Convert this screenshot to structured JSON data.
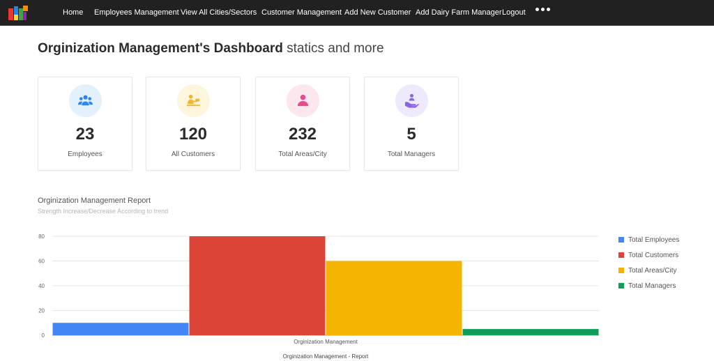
{
  "navbar": {
    "items": [
      "Home",
      "Employees Management",
      "View All Cities/Sectors",
      "Customer Management",
      "Add New Customer",
      "Add Dairy Farm Manager",
      "Logout"
    ]
  },
  "page": {
    "title_strong": "Orginization Management's Dashboard",
    "title_light": "statics and more"
  },
  "cards": [
    {
      "value": "23",
      "label": "Employees",
      "icon": "users-icon",
      "circle_color": "#e3f0fd",
      "icon_color": "#2f86e8"
    },
    {
      "value": "120",
      "label": "All Customers",
      "icon": "customer-desk-icon",
      "circle_color": "#fef6dc",
      "icon_color": "#f2b632"
    },
    {
      "value": "232",
      "label": "Total Areas/City",
      "icon": "person-icon",
      "circle_color": "#fde7ee",
      "icon_color": "#e64b8d"
    },
    {
      "value": "5",
      "label": "Total Managers",
      "icon": "manager-hand-icon",
      "circle_color": "#eee9fd",
      "icon_color": "#8a63e6"
    }
  ],
  "report": {
    "title": "Orginization Management Report",
    "subtitle": "Strength Increase/Decrease According to trend"
  },
  "chart_data": {
    "type": "bar",
    "categories": [
      "Orginization Management"
    ],
    "series": [
      {
        "name": "Total Employees",
        "values": [
          10
        ],
        "color": "#4285f4"
      },
      {
        "name": "Total Customers",
        "values": [
          80
        ],
        "color": "#db4437"
      },
      {
        "name": "Total Areas/City",
        "values": [
          60
        ],
        "color": "#f4b400"
      },
      {
        "name": "Total Managers",
        "values": [
          5
        ],
        "color": "#0f9d58"
      }
    ],
    "title": "",
    "xlabel": "Orginization Management - Report",
    "ylabel": "",
    "ylim": [
      0,
      80
    ],
    "yticks": [
      0,
      20,
      40,
      60,
      80
    ],
    "grid": true,
    "legend_position": "right"
  }
}
